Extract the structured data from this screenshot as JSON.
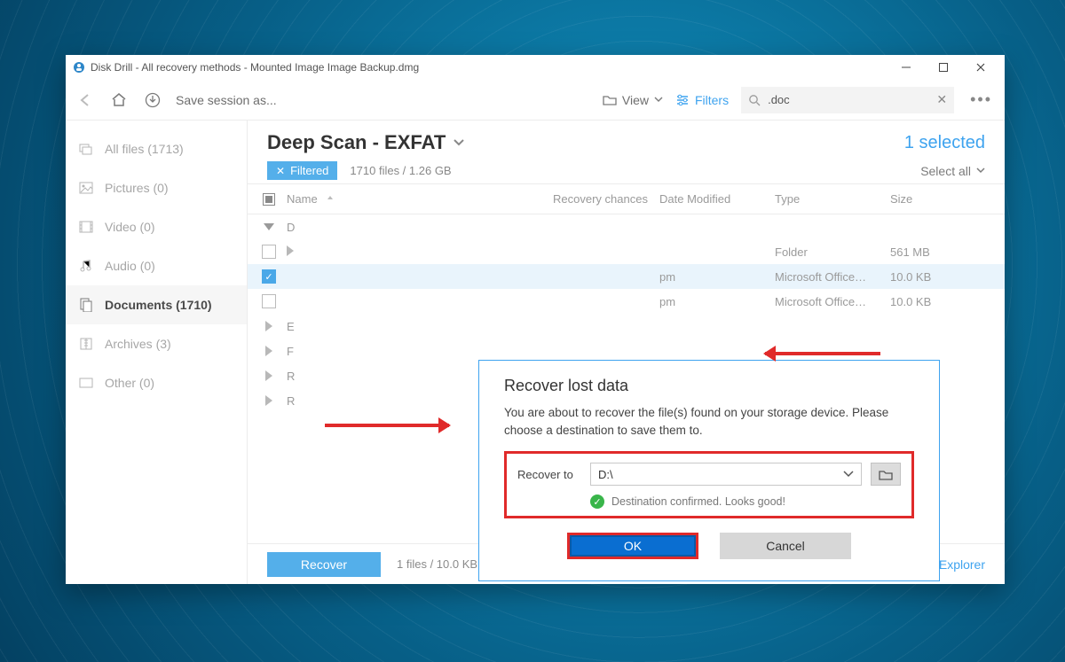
{
  "titlebar": {
    "title": "Disk Drill - All recovery methods - Mounted Image Image Backup.dmg"
  },
  "toolbar": {
    "save_session": "Save session as...",
    "view_label": "View",
    "filters_label": "Filters",
    "search_value": ".doc"
  },
  "sidebar": {
    "items": [
      {
        "label": "All files (1713)"
      },
      {
        "label": "Pictures (0)"
      },
      {
        "label": "Video (0)"
      },
      {
        "label": "Audio (0)"
      },
      {
        "label": "Documents (1710)"
      },
      {
        "label": "Archives (3)"
      },
      {
        "label": "Other (0)"
      }
    ]
  },
  "main": {
    "scan_title": "Deep Scan - EXFAT",
    "chip": "Filtered",
    "summary": "1710 files / 1.26 GB",
    "selected_text": "1 selected",
    "select_all": "Select all"
  },
  "columns": {
    "name": "Name",
    "recovery": "Recovery chances",
    "date": "Date Modified",
    "type": "Type",
    "size": "Size"
  },
  "rows": {
    "r0": {
      "name": "D"
    },
    "r1": {
      "date": "",
      "type": "Folder",
      "size": "561 MB"
    },
    "r2": {
      "date": "pm",
      "type": "Microsoft Office…",
      "size": "10.0 KB"
    },
    "r3": {
      "date": "pm",
      "type": "Microsoft Office…",
      "size": "10.0 KB"
    },
    "r4": {
      "name": "E"
    },
    "r5": {
      "name": "F"
    },
    "r6": {
      "name": "R"
    },
    "r7": {
      "name": "R"
    }
  },
  "dialog": {
    "title": "Recover lost data",
    "body": "You are about to recover the file(s) found on your storage device. Please choose a destination to save them to.",
    "recover_to": "Recover to",
    "destination": "D:\\",
    "confirm_text": "Destination confirmed. Looks good!",
    "ok": "OK",
    "cancel": "Cancel"
  },
  "footer": {
    "recover": "Recover",
    "summary": "1 files / 10.0 KB",
    "explorer": "Show scan results in Explorer"
  }
}
